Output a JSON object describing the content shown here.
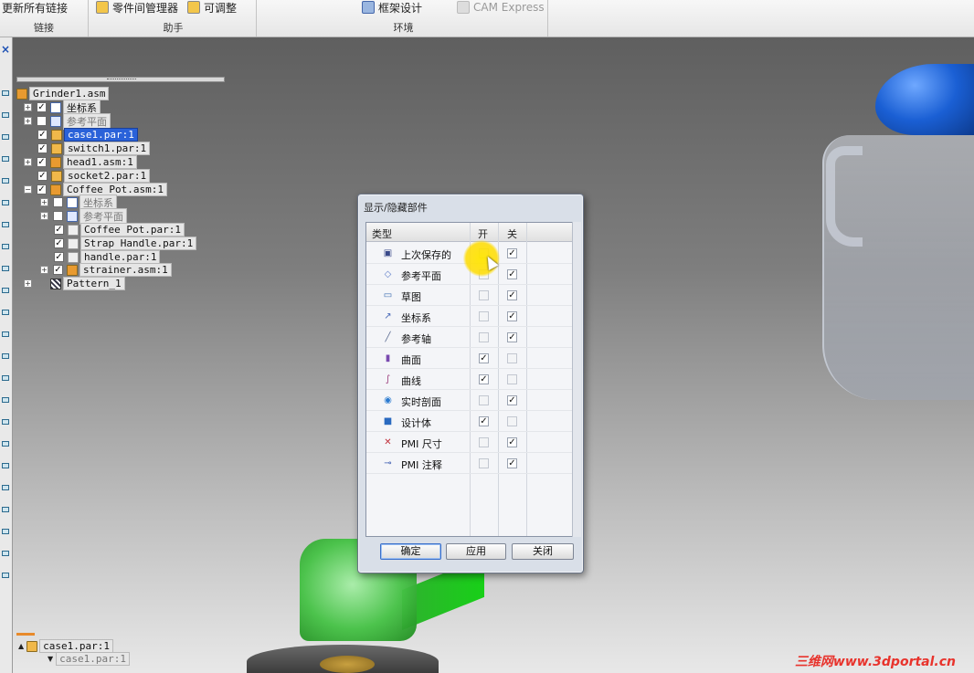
{
  "ribbon": {
    "buttons": [
      {
        "label": "更新所有链接",
        "disabled": false
      },
      {
        "label": "零件间管理器",
        "disabled": false
      },
      {
        "label": "可调整",
        "disabled": false
      },
      {
        "label": "框架设计",
        "disabled": false
      },
      {
        "label": "CAM Express",
        "disabled": true
      }
    ],
    "groups": [
      "链接",
      "助手",
      "环境"
    ]
  },
  "tree": {
    "items": [
      {
        "label": "Grinder1.asm",
        "level": 0,
        "expander": "",
        "checked": null,
        "icon": "assembly-icon",
        "selected": false,
        "dim": false
      },
      {
        "label": "坐标系",
        "level": 1,
        "expander": "+",
        "checked": true,
        "icon": "coordinate-system-icon",
        "selected": false,
        "dim": false
      },
      {
        "label": "参考平面",
        "level": 1,
        "expander": "+",
        "checked": false,
        "icon": "reference-plane-icon",
        "selected": false,
        "dim": true
      },
      {
        "label": "case1.par:1",
        "level": 1,
        "expander": "",
        "checked": true,
        "icon": "part-icon",
        "selected": true,
        "dim": false
      },
      {
        "label": "switch1.par:1",
        "level": 1,
        "expander": "",
        "checked": true,
        "icon": "part-icon",
        "selected": false,
        "dim": false
      },
      {
        "label": "head1.asm:1",
        "level": 1,
        "expander": "+",
        "checked": true,
        "icon": "assembly-icon",
        "selected": false,
        "dim": false
      },
      {
        "label": "socket2.par:1",
        "level": 1,
        "expander": "",
        "checked": true,
        "icon": "part-icon",
        "selected": false,
        "dim": false
      },
      {
        "label": "Coffee Pot.asm:1",
        "level": 1,
        "expander": "−",
        "checked": true,
        "icon": "assembly-icon",
        "selected": false,
        "dim": false
      },
      {
        "label": "坐标系",
        "level": 2,
        "expander": "+",
        "checked": false,
        "icon": "coordinate-system-icon",
        "selected": false,
        "dim": true
      },
      {
        "label": "参考平面",
        "level": 2,
        "expander": "+",
        "checked": false,
        "icon": "reference-plane-icon",
        "selected": false,
        "dim": true
      },
      {
        "label": "Coffee Pot.par:1",
        "level": 2,
        "expander": "",
        "checked": true,
        "icon": "part-icon",
        "selected": false,
        "dim": false
      },
      {
        "label": "Strap Handle.par:1",
        "level": 2,
        "expander": "",
        "checked": true,
        "icon": "part-icon",
        "selected": false,
        "dim": false
      },
      {
        "label": "handle.par:1",
        "level": 2,
        "expander": "",
        "checked": true,
        "icon": "part-icon",
        "selected": false,
        "dim": false
      },
      {
        "label": "strainer.asm:1",
        "level": 2,
        "expander": "+",
        "checked": true,
        "icon": "assembly-icon",
        "selected": false,
        "dim": false
      },
      {
        "label": "Pattern_1",
        "level": 1,
        "expander": "+",
        "checked": null,
        "icon": "pattern-icon",
        "selected": false,
        "dim": false
      }
    ]
  },
  "bottom_pane": {
    "items": [
      "case1.par:1",
      "case1.par:1"
    ]
  },
  "dialog": {
    "title": "显示/隐藏部件",
    "columns": [
      "类型",
      "开",
      "关"
    ],
    "rows": [
      {
        "label": "上次保存的",
        "icon": "save-icon",
        "on": false,
        "off": true
      },
      {
        "label": "参考平面",
        "icon": "reference-plane-icon",
        "on": false,
        "off": true
      },
      {
        "label": "草图",
        "icon": "sketch-icon",
        "on": false,
        "off": true
      },
      {
        "label": "坐标系",
        "icon": "coordinate-system-icon",
        "on": false,
        "off": true
      },
      {
        "label": "参考轴",
        "icon": "reference-axis-icon",
        "on": false,
        "off": true
      },
      {
        "label": "曲面",
        "icon": "surface-icon",
        "on": true,
        "off": false
      },
      {
        "label": "曲线",
        "icon": "curve-icon",
        "on": true,
        "off": false
      },
      {
        "label": "实时剖面",
        "icon": "live-section-icon",
        "on": false,
        "off": true
      },
      {
        "label": "设计体",
        "icon": "design-body-icon",
        "on": true,
        "off": false
      },
      {
        "label": "PMI 尺寸",
        "icon": "pmi-dimension-icon",
        "on": false,
        "off": true
      },
      {
        "label": "PMI 注释",
        "icon": "pmi-annotation-icon",
        "on": false,
        "off": true
      }
    ],
    "buttons": {
      "ok": "确定",
      "apply": "应用",
      "close": "关闭"
    }
  },
  "watermark": "三维网www.3dportal.cn",
  "colors": {
    "selection": "#2a62d9",
    "accent_blue": "#1a5fd4",
    "model_green": "#45c245",
    "cursor_highlight": "#ffe600"
  }
}
